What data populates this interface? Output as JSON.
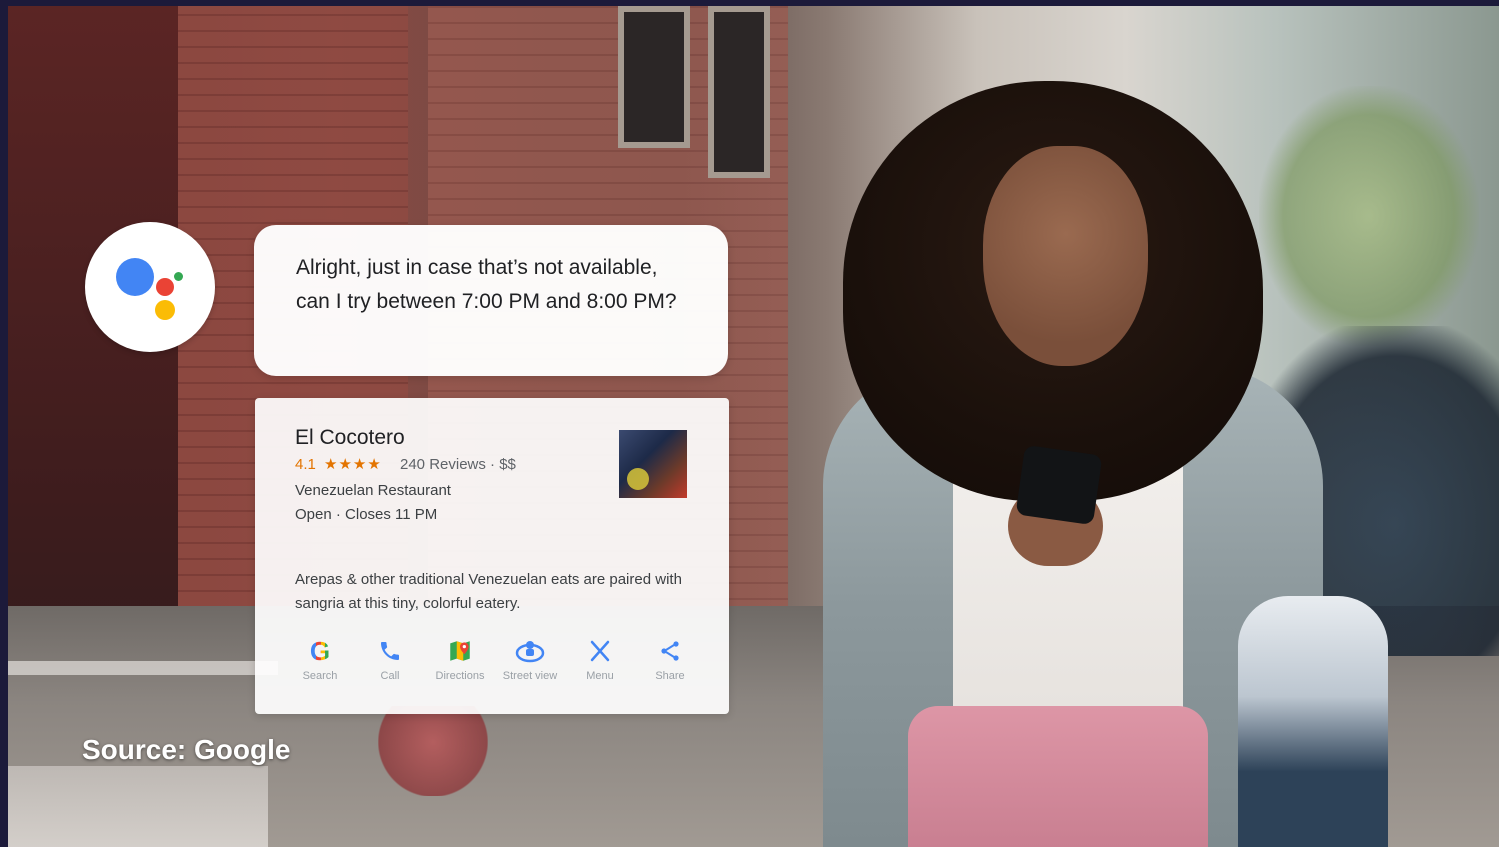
{
  "assistant": {
    "message": "Alright, just in case that’s not available, can I try between 7:00 PM and 8:00 PM?"
  },
  "place_card": {
    "name": "El Cocotero",
    "rating": "4.1",
    "stars": "★★★★",
    "reviews": "240 Reviews · $$",
    "type": "Venezuelan Restaurant",
    "hours": "Open · Closes 11 PM",
    "description": "Arepas & other traditional Venezuelan eats are paired with sangria at this tiny, colorful eatery.",
    "actions": [
      {
        "label": "Search",
        "icon": "google-g-icon"
      },
      {
        "label": "Call",
        "icon": "phone-icon"
      },
      {
        "label": "Directions",
        "icon": "maps-icon"
      },
      {
        "label": "Street view",
        "icon": "street-view-icon"
      },
      {
        "label": "Menu",
        "icon": "utensils-icon"
      },
      {
        "label": "Share",
        "icon": "share-icon"
      }
    ]
  },
  "caption": "Source: Google",
  "colors": {
    "google_blue": "#4285f4",
    "google_red": "#ea4335",
    "google_yellow": "#fbbc05",
    "google_green": "#34a853",
    "rating_orange": "#e37400"
  }
}
